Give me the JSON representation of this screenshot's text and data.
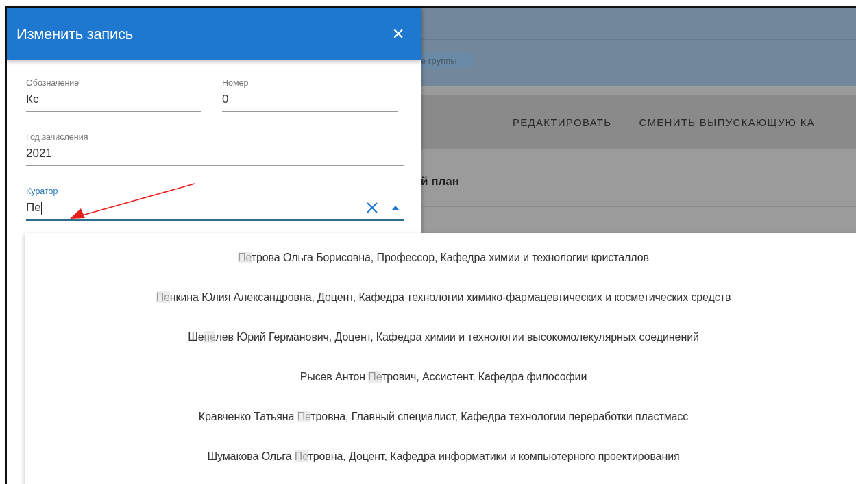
{
  "background": {
    "chip": "е группы",
    "toolbar_buttons": [
      "РЕДАКТИРОВАТЬ",
      "СМЕНИТЬ ВЫПУСКАЮЩУЮ КА"
    ],
    "section_title": "й план"
  },
  "dialog": {
    "title": "Изменить запись",
    "close": "✕",
    "fields": [
      {
        "label": "Обозначение",
        "value": "Кс",
        "kind": "text",
        "focused": false,
        "half": true
      },
      {
        "label": "Номер",
        "value": "0",
        "kind": "text",
        "focused": false,
        "half": true
      },
      {
        "label": "Год зачисления",
        "value": "2021",
        "kind": "text",
        "focused": false,
        "half": false
      },
      {
        "label": "Куратор",
        "value": "Пе",
        "kind": "combobox",
        "focused": true,
        "half": false
      }
    ]
  },
  "dropdown": {
    "options": [
      {
        "parts": [
          {
            "text": "Пе",
            "highlighted": true
          },
          {
            "text": "трова Ольга Борисовна, Профессор, Кафедра химии и технологии кристаллов",
            "highlighted": false
          }
        ]
      },
      {
        "parts": [
          {
            "text": "Пе",
            "highlighted": true
          },
          {
            "text": "нкина Юлия Александровна, Доцент, Кафедра технологии химико-фармацевтических и косметических средств",
            "highlighted": false
          }
        ]
      },
      {
        "parts": [
          {
            "text": "Ше",
            "highlighted": false
          },
          {
            "text": "пе",
            "highlighted": true
          },
          {
            "text": "лев Юрий Германович, Доцент, Кафедра химии и технологии высокомолекулярных соединений",
            "highlighted": false
          }
        ]
      },
      {
        "parts": [
          {
            "text": "Рысев Антон ",
            "highlighted": false
          },
          {
            "text": "Пе",
            "highlighted": true
          },
          {
            "text": "трович, Ассистент, Кафедра философии",
            "highlighted": false
          }
        ]
      },
      {
        "parts": [
          {
            "text": "Кравченко Татьяна ",
            "highlighted": false
          },
          {
            "text": "Пе",
            "highlighted": true
          },
          {
            "text": "тровна, Главный специалист, Кафедра технологии переработки пластмасс",
            "highlighted": false
          }
        ]
      },
      {
        "parts": [
          {
            "text": "Шумакова Ольга ",
            "highlighted": false
          },
          {
            "text": "Пе",
            "highlighted": true
          },
          {
            "text": "тровна, Доцент, Кафедра информатики и компьютерного проектирования",
            "highlighted": false
          }
        ]
      }
    ]
  }
}
